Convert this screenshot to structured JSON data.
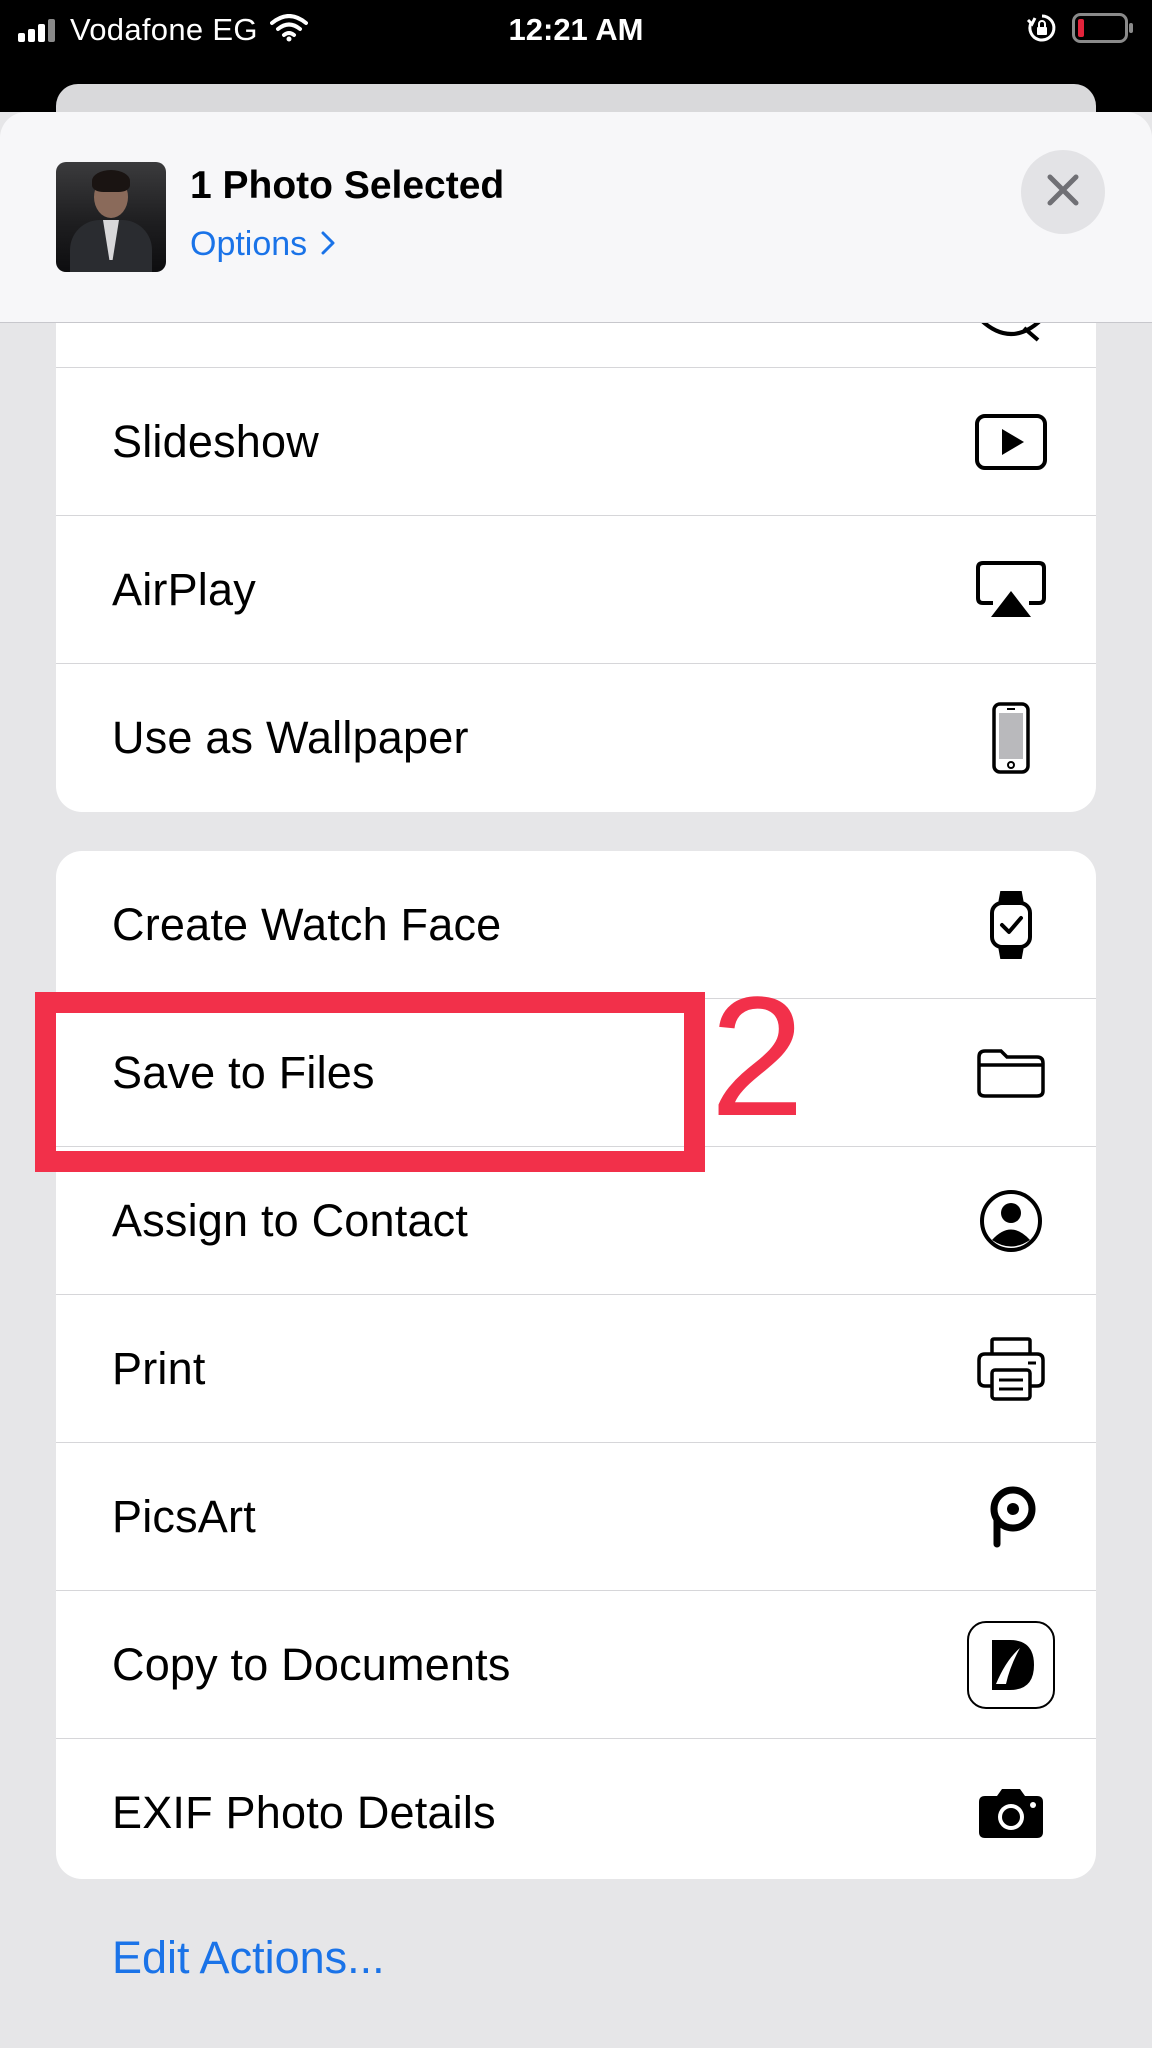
{
  "status_bar": {
    "carrier": "Vodafone EG",
    "time": "12:21 AM",
    "icons": [
      "signal-icon",
      "wifi-icon",
      "orientation-lock-icon",
      "battery-icon"
    ]
  },
  "header": {
    "title": "1 Photo Selected",
    "options_label": "Options",
    "options_chevron": "›",
    "close_icon": "close-icon"
  },
  "groups": [
    {
      "items": [
        {
          "label": "Slideshow",
          "icon": "play-icon"
        },
        {
          "label": "AirPlay",
          "icon": "airplay-icon"
        },
        {
          "label": "Use as Wallpaper",
          "icon": "phone-icon"
        }
      ]
    },
    {
      "items": [
        {
          "label": "Create Watch Face",
          "icon": "watch-icon"
        },
        {
          "label": "Save to Files",
          "icon": "folder-icon"
        },
        {
          "label": "Assign to Contact",
          "icon": "person-circle-icon"
        },
        {
          "label": "Print",
          "icon": "printer-icon"
        },
        {
          "label": "PicsArt",
          "icon": "picsart-icon"
        },
        {
          "label": "Copy to Documents",
          "icon": "documents-app-icon"
        },
        {
          "label": "EXIF Photo Details",
          "icon": "camera-icon"
        }
      ]
    }
  ],
  "edit_actions_label": "Edit Actions...",
  "annotation": {
    "number": "2",
    "color": "#f2304a"
  },
  "colors": {
    "accent": "#1a73e8",
    "annotation": "#f2304a"
  }
}
